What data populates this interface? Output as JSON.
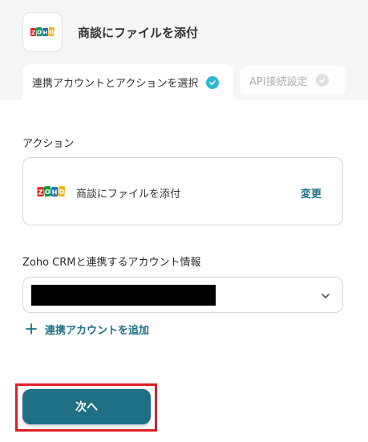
{
  "header": {
    "title": "商談にファイルを添付",
    "logo_icon": "zoho-logo-icon"
  },
  "tabs": [
    {
      "label": "連携アカウントとアクションを選択",
      "state": "active",
      "icon": "check-circle-icon"
    },
    {
      "label": "API接続設定",
      "state": "inactive",
      "icon": "check-circle-icon"
    }
  ],
  "action_section": {
    "label": "アクション",
    "action_name": "商談にファイルを添付",
    "change_label": "変更",
    "icon": "zoho-logo-icon"
  },
  "account_section": {
    "label": "Zoho CRMと連携するアカウント情報",
    "selected_value": "",
    "add_account_label": "連携アカウントを追加"
  },
  "next_button": {
    "label": "次へ"
  },
  "colors": {
    "accent": "#1f6f86",
    "check_active": "#31b7d1",
    "highlight": "#e01e24"
  }
}
